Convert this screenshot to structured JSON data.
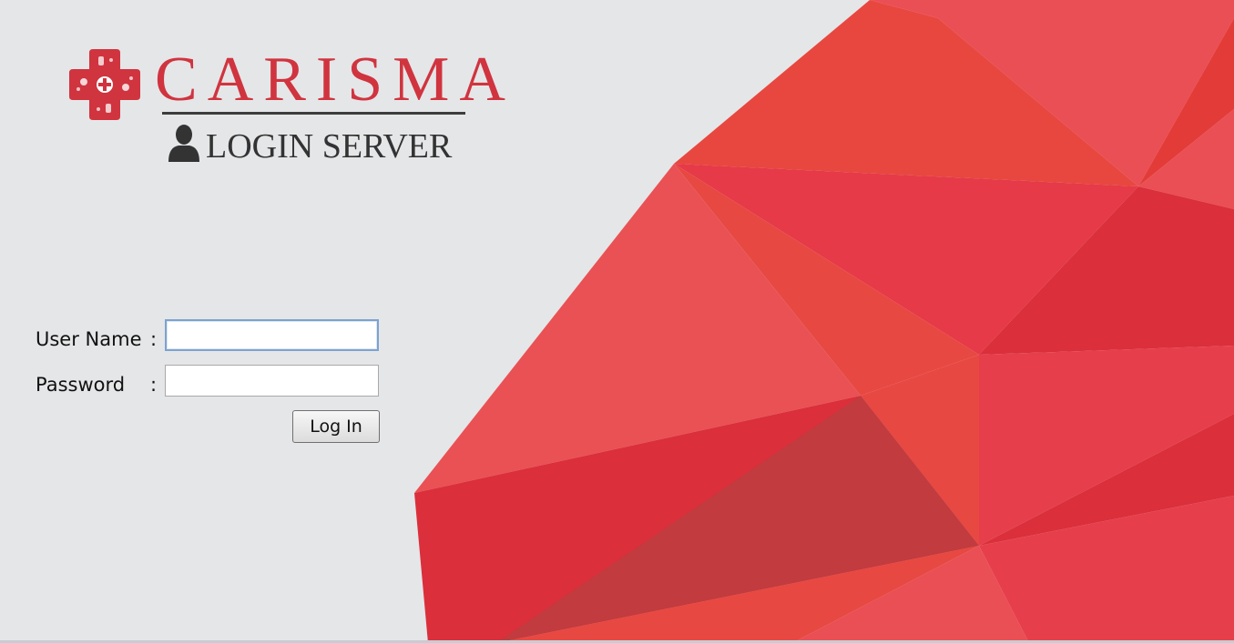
{
  "brand": {
    "name": "CARISMA",
    "subtitle": "LOGIN SERVER",
    "icon": "medical-cross-icon",
    "user_icon": "user-icon"
  },
  "form": {
    "username_label": "User Name",
    "password_label": "Password",
    "separator": ":",
    "username_value": "",
    "password_value": "",
    "submit_label": "Log In"
  },
  "colors": {
    "brand_red": "#d0343f",
    "background": "#e5e6e8",
    "text_dark": "#333333"
  }
}
